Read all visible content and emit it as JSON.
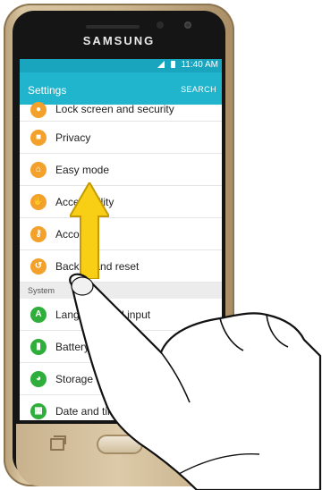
{
  "device": {
    "brand": "SAMSUNG"
  },
  "status_bar": {
    "time": "11:40 AM"
  },
  "app_bar": {
    "title": "Settings",
    "search_label": "SEARCH"
  },
  "list": {
    "partial_item": {
      "label": "Lock screen and security",
      "icon": "lock-icon"
    },
    "items": [
      {
        "label": "Privacy",
        "icon": "privacy-icon",
        "color": "#f3a12a"
      },
      {
        "label": "Easy mode",
        "icon": "easy-mode-icon",
        "color": "#f3a12a"
      },
      {
        "label": "Accessibility",
        "icon": "accessibility-icon",
        "color": "#f3a12a"
      },
      {
        "label": "Accounts",
        "icon": "key-icon",
        "color": "#f3a12a"
      },
      {
        "label": "Backup and reset",
        "icon": "backup-icon",
        "color": "#f3a12a"
      }
    ],
    "section_header": "System",
    "system_items": [
      {
        "label": "Language and input",
        "icon": "language-icon",
        "color": "#2fae3b"
      },
      {
        "label": "Battery",
        "icon": "battery-icon",
        "color": "#2fae3b"
      },
      {
        "label": "Storage",
        "icon": "storage-icon",
        "color": "#2fae3b"
      },
      {
        "label": "Date and time",
        "icon": "calendar-icon",
        "color": "#2fae3b"
      }
    ]
  },
  "overlay": {
    "gesture": "swipe-up",
    "arrow_color": "#f8cf14"
  }
}
